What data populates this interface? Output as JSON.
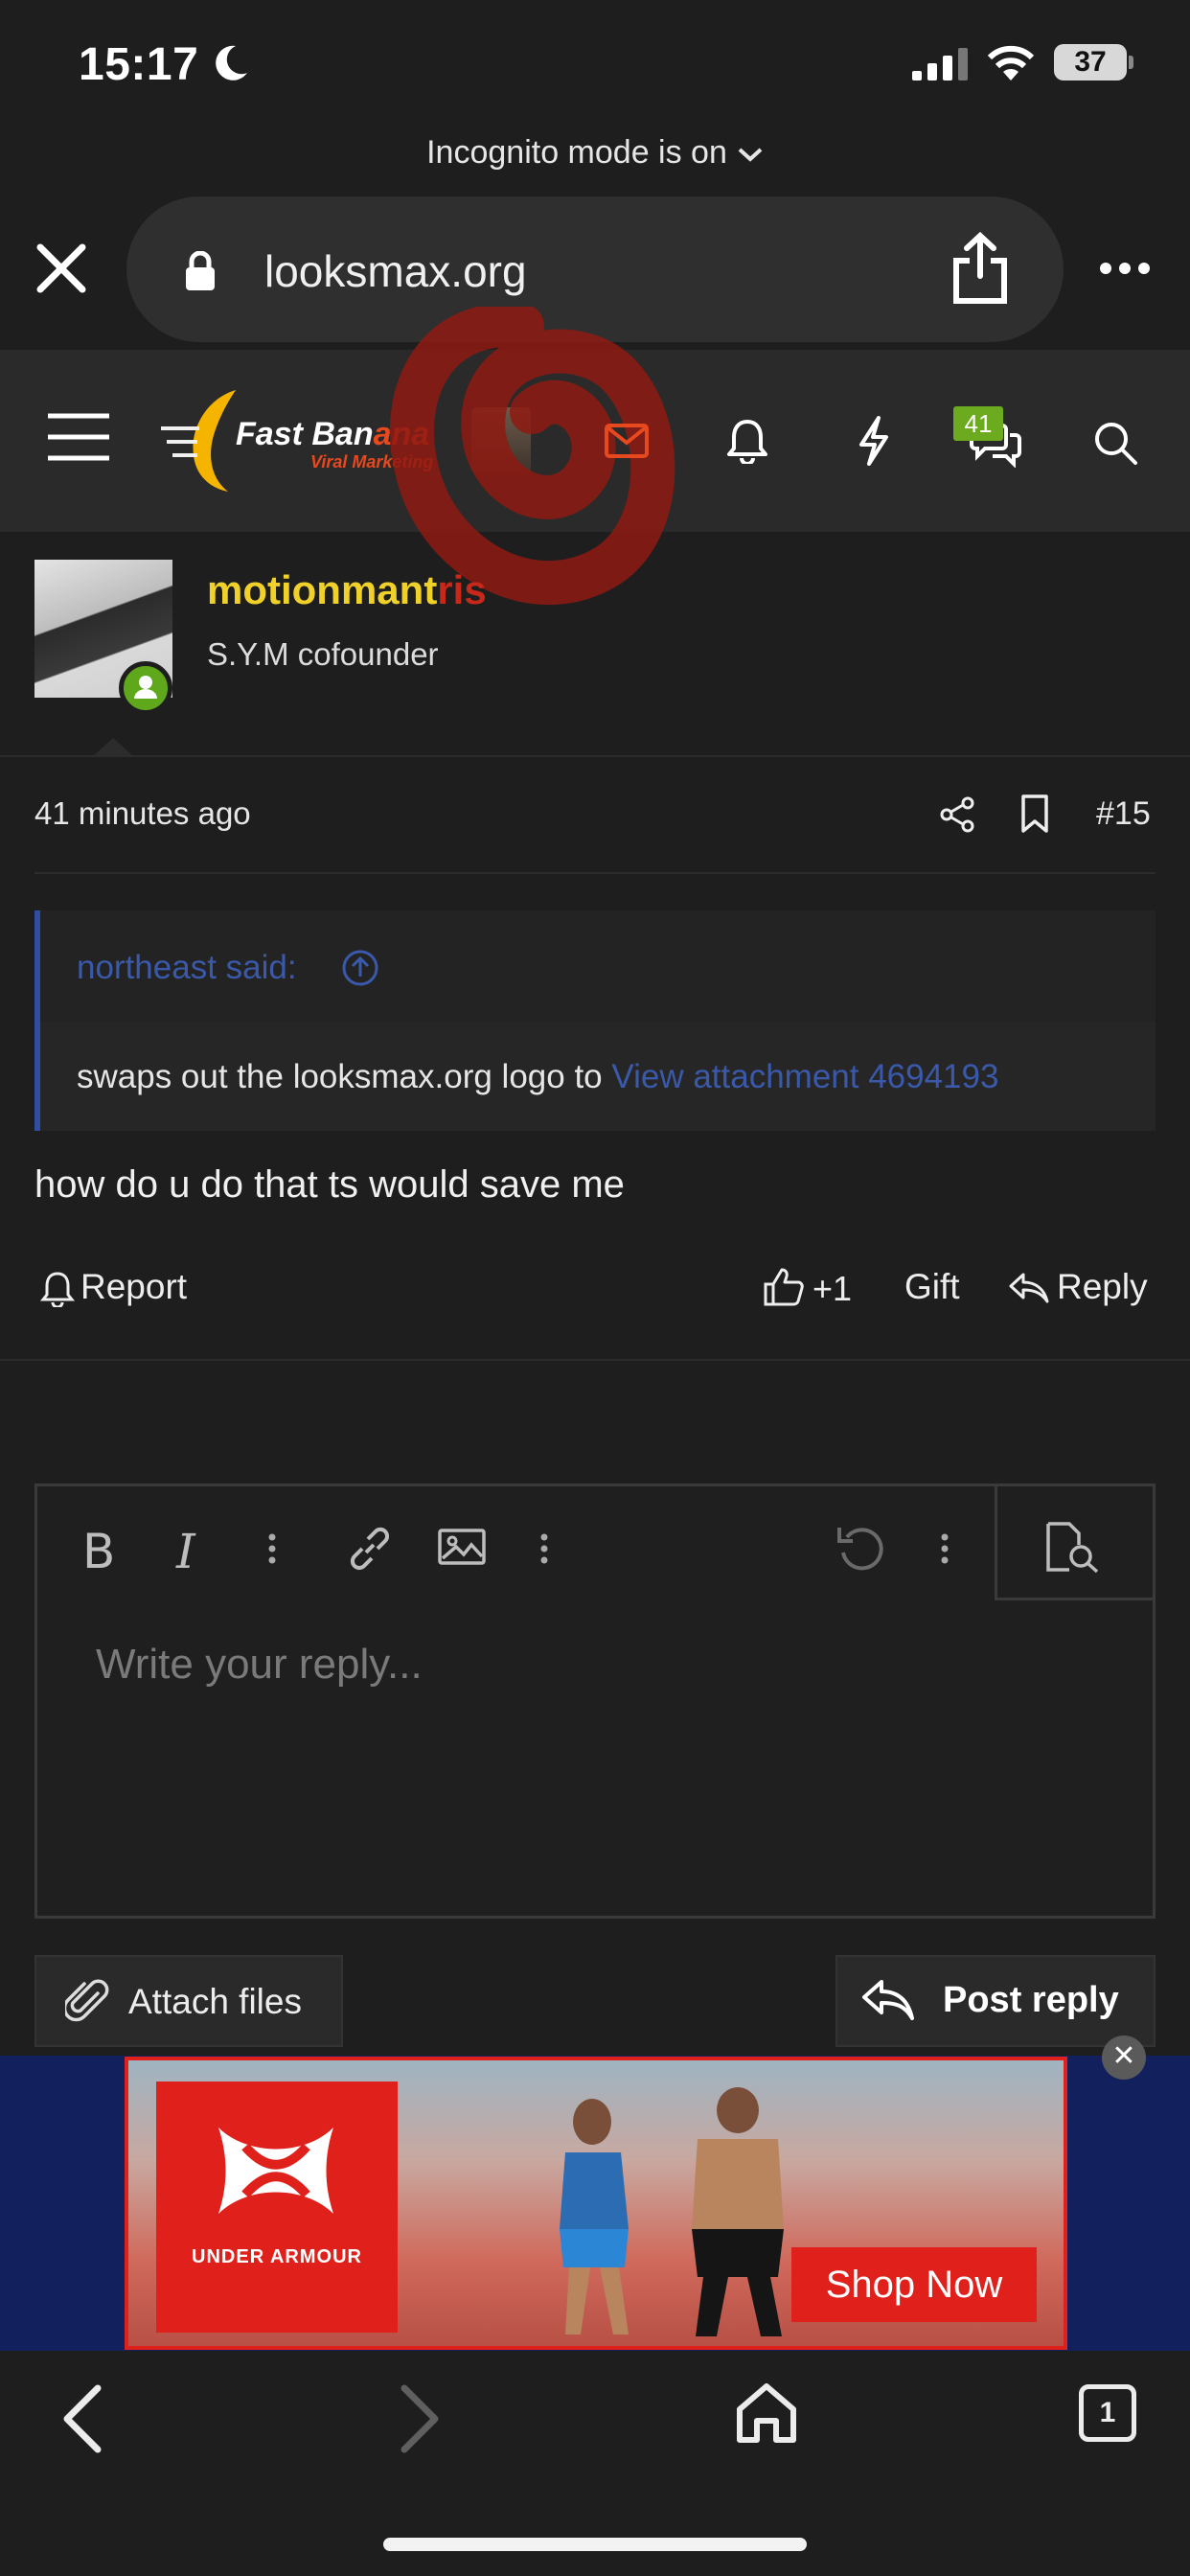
{
  "status_bar": {
    "time": "15:17",
    "battery": "37"
  },
  "browser": {
    "incognito_label": "Incognito mode is on",
    "url": "looksmax.org"
  },
  "site_header": {
    "logo_text_1": "Fast Ban",
    "logo_text_2": "ana",
    "logo_subtext": "Viral Marketing",
    "chat_badge_count": "41"
  },
  "post": {
    "username_1": "motionmant",
    "username_2": "ris",
    "user_title": "S.Y.M cofounder",
    "time": "41 minutes ago",
    "number": "#15",
    "quote": {
      "author": "northeast said:",
      "text": "swaps out the looksmax.org logo to ",
      "link_text": "View attachment 4694193"
    },
    "body": "how do u do that ts would save me",
    "actions": {
      "report": "Report",
      "like_count": "+1",
      "gift": "Gift",
      "reply": "Reply"
    }
  },
  "editor": {
    "bold": "B",
    "italic": "I",
    "placeholder": "Write your reply...",
    "attach_label": "Attach files",
    "post_reply_label": "Post reply"
  },
  "ad": {
    "brand": "UNDER ARMOUR",
    "cta": "Shop Now",
    "close": "✕"
  },
  "bottom_bar": {
    "tab_count": "1"
  },
  "colors": {
    "accent_blue": "#3a59aa",
    "username_yellow": "#f0d12a",
    "badge_green": "#6cab1f",
    "mail_red": "#e8481e"
  }
}
